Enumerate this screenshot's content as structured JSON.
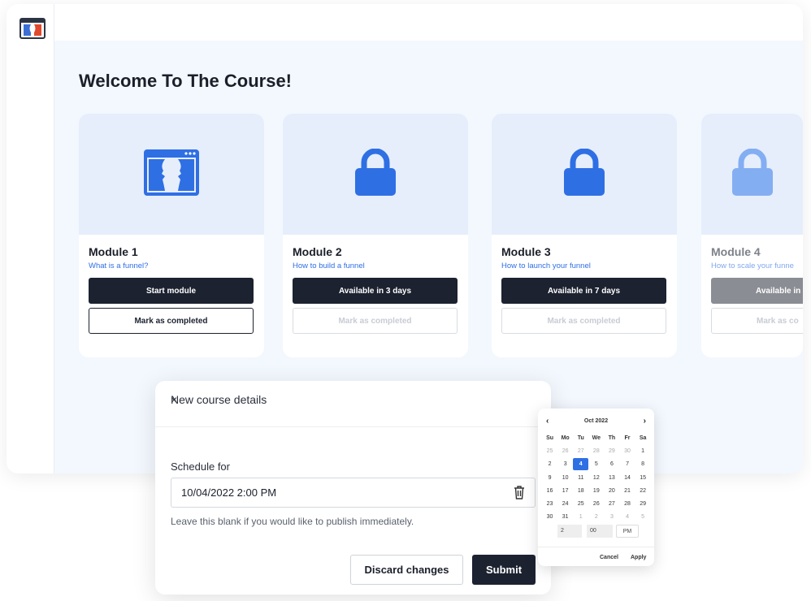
{
  "page": {
    "title": "Welcome To The Course!"
  },
  "modules": [
    {
      "title": "Module 1",
      "subtitle": "What is a funnel?",
      "primary": "Start module",
      "secondary": "Mark as completed",
      "icon": "clickfunnels-logo-icon"
    },
    {
      "title": "Module 2",
      "subtitle": "How to build a funnel",
      "primary": "Available in 3 days",
      "secondary": "Mark as completed",
      "icon": "lock-icon"
    },
    {
      "title": "Module 3",
      "subtitle": "How to launch your funnel",
      "primary": "Available in 7 days",
      "secondary": "Mark as completed",
      "icon": "lock-icon"
    },
    {
      "title": "Module 4",
      "subtitle": "How to scale your funne",
      "primary": "Available in",
      "secondary": "Mark as co",
      "icon": "lock-icon"
    }
  ],
  "modal": {
    "title": "New course details",
    "close": "×",
    "schedule_label": "Schedule for",
    "schedule_value": "10/04/2022 2:00 PM",
    "help": "Leave this blank if you would like to publish immediately.",
    "discard": "Discard changes",
    "submit": "Submit"
  },
  "calendar": {
    "month": "Oct 2022",
    "prev": "‹",
    "next": "›",
    "weekdays": [
      "Su",
      "Mo",
      "Tu",
      "We",
      "Th",
      "Fr",
      "Sa"
    ],
    "days": [
      "25",
      "26",
      "27",
      "28",
      "29",
      "30",
      "1",
      "2",
      "3",
      "4",
      "5",
      "6",
      "7",
      "8",
      "9",
      "10",
      "11",
      "12",
      "13",
      "14",
      "15",
      "16",
      "17",
      "18",
      "19",
      "20",
      "21",
      "22",
      "23",
      "24",
      "25",
      "26",
      "27",
      "28",
      "29",
      "30",
      "31",
      "1",
      "2",
      "3",
      "4",
      "5"
    ],
    "selected": "4",
    "hour": "2",
    "sep": ":",
    "minute": "00",
    "ampm": "PM",
    "cancel": "Cancel",
    "apply": "Apply"
  },
  "colors": {
    "accent": "#2f6fe4",
    "dark": "#1c2230",
    "background": "#f3f8fe"
  }
}
